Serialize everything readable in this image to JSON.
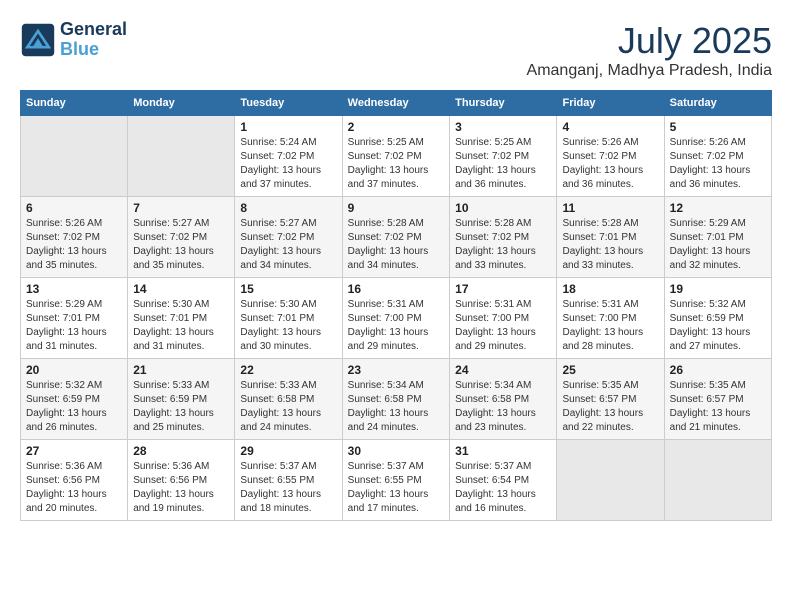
{
  "header": {
    "logo_line1": "General",
    "logo_line2": "Blue",
    "month": "July 2025",
    "location": "Amanganj, Madhya Pradesh, India"
  },
  "days_of_week": [
    "Sunday",
    "Monday",
    "Tuesday",
    "Wednesday",
    "Thursday",
    "Friday",
    "Saturday"
  ],
  "weeks": [
    [
      {
        "day": "",
        "info": ""
      },
      {
        "day": "",
        "info": ""
      },
      {
        "day": "1",
        "info": "Sunrise: 5:24 AM\nSunset: 7:02 PM\nDaylight: 13 hours and 37 minutes."
      },
      {
        "day": "2",
        "info": "Sunrise: 5:25 AM\nSunset: 7:02 PM\nDaylight: 13 hours and 37 minutes."
      },
      {
        "day": "3",
        "info": "Sunrise: 5:25 AM\nSunset: 7:02 PM\nDaylight: 13 hours and 36 minutes."
      },
      {
        "day": "4",
        "info": "Sunrise: 5:26 AM\nSunset: 7:02 PM\nDaylight: 13 hours and 36 minutes."
      },
      {
        "day": "5",
        "info": "Sunrise: 5:26 AM\nSunset: 7:02 PM\nDaylight: 13 hours and 36 minutes."
      }
    ],
    [
      {
        "day": "6",
        "info": "Sunrise: 5:26 AM\nSunset: 7:02 PM\nDaylight: 13 hours and 35 minutes."
      },
      {
        "day": "7",
        "info": "Sunrise: 5:27 AM\nSunset: 7:02 PM\nDaylight: 13 hours and 35 minutes."
      },
      {
        "day": "8",
        "info": "Sunrise: 5:27 AM\nSunset: 7:02 PM\nDaylight: 13 hours and 34 minutes."
      },
      {
        "day": "9",
        "info": "Sunrise: 5:28 AM\nSunset: 7:02 PM\nDaylight: 13 hours and 34 minutes."
      },
      {
        "day": "10",
        "info": "Sunrise: 5:28 AM\nSunset: 7:02 PM\nDaylight: 13 hours and 33 minutes."
      },
      {
        "day": "11",
        "info": "Sunrise: 5:28 AM\nSunset: 7:01 PM\nDaylight: 13 hours and 33 minutes."
      },
      {
        "day": "12",
        "info": "Sunrise: 5:29 AM\nSunset: 7:01 PM\nDaylight: 13 hours and 32 minutes."
      }
    ],
    [
      {
        "day": "13",
        "info": "Sunrise: 5:29 AM\nSunset: 7:01 PM\nDaylight: 13 hours and 31 minutes."
      },
      {
        "day": "14",
        "info": "Sunrise: 5:30 AM\nSunset: 7:01 PM\nDaylight: 13 hours and 31 minutes."
      },
      {
        "day": "15",
        "info": "Sunrise: 5:30 AM\nSunset: 7:01 PM\nDaylight: 13 hours and 30 minutes."
      },
      {
        "day": "16",
        "info": "Sunrise: 5:31 AM\nSunset: 7:00 PM\nDaylight: 13 hours and 29 minutes."
      },
      {
        "day": "17",
        "info": "Sunrise: 5:31 AM\nSunset: 7:00 PM\nDaylight: 13 hours and 29 minutes."
      },
      {
        "day": "18",
        "info": "Sunrise: 5:31 AM\nSunset: 7:00 PM\nDaylight: 13 hours and 28 minutes."
      },
      {
        "day": "19",
        "info": "Sunrise: 5:32 AM\nSunset: 6:59 PM\nDaylight: 13 hours and 27 minutes."
      }
    ],
    [
      {
        "day": "20",
        "info": "Sunrise: 5:32 AM\nSunset: 6:59 PM\nDaylight: 13 hours and 26 minutes."
      },
      {
        "day": "21",
        "info": "Sunrise: 5:33 AM\nSunset: 6:59 PM\nDaylight: 13 hours and 25 minutes."
      },
      {
        "day": "22",
        "info": "Sunrise: 5:33 AM\nSunset: 6:58 PM\nDaylight: 13 hours and 24 minutes."
      },
      {
        "day": "23",
        "info": "Sunrise: 5:34 AM\nSunset: 6:58 PM\nDaylight: 13 hours and 24 minutes."
      },
      {
        "day": "24",
        "info": "Sunrise: 5:34 AM\nSunset: 6:58 PM\nDaylight: 13 hours and 23 minutes."
      },
      {
        "day": "25",
        "info": "Sunrise: 5:35 AM\nSunset: 6:57 PM\nDaylight: 13 hours and 22 minutes."
      },
      {
        "day": "26",
        "info": "Sunrise: 5:35 AM\nSunset: 6:57 PM\nDaylight: 13 hours and 21 minutes."
      }
    ],
    [
      {
        "day": "27",
        "info": "Sunrise: 5:36 AM\nSunset: 6:56 PM\nDaylight: 13 hours and 20 minutes."
      },
      {
        "day": "28",
        "info": "Sunrise: 5:36 AM\nSunset: 6:56 PM\nDaylight: 13 hours and 19 minutes."
      },
      {
        "day": "29",
        "info": "Sunrise: 5:37 AM\nSunset: 6:55 PM\nDaylight: 13 hours and 18 minutes."
      },
      {
        "day": "30",
        "info": "Sunrise: 5:37 AM\nSunset: 6:55 PM\nDaylight: 13 hours and 17 minutes."
      },
      {
        "day": "31",
        "info": "Sunrise: 5:37 AM\nSunset: 6:54 PM\nDaylight: 13 hours and 16 minutes."
      },
      {
        "day": "",
        "info": ""
      },
      {
        "day": "",
        "info": ""
      }
    ]
  ]
}
